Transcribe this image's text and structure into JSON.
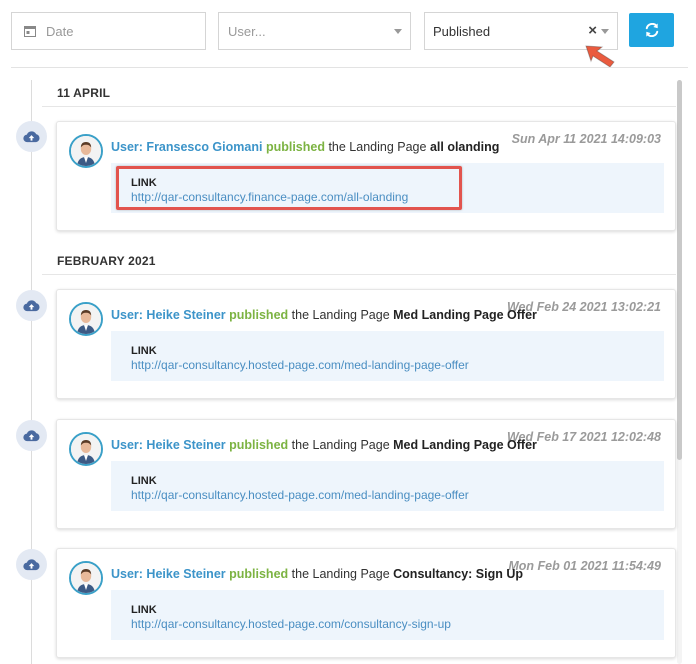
{
  "filters": {
    "date_placeholder": "Date",
    "user_placeholder": "User...",
    "status_value": "Published",
    "clear_symbol": "×"
  },
  "icons": {
    "calendar": "calendar-icon",
    "refresh": "refresh-icon",
    "timeline": "cloud-upload-icon",
    "arrow": "arrow-pointer-icon"
  },
  "colors": {
    "accent": "#1fa5e0",
    "user_link": "#3c94c9",
    "verb_published": "#7cb342",
    "highlight": "#e2544e",
    "link_box": "#eef5fc"
  },
  "sections": [
    {
      "header": "11 APRIL"
    },
    {
      "header": "FEBRUARY 2021"
    }
  ],
  "entries": [
    {
      "timestamp": "Sun Apr 11 2021 14:09:03",
      "user": "User: Fransesco Giomani",
      "verb": "published",
      "object_prefix": "the Landing Page",
      "object_name": "all olanding",
      "link_label": "LINK",
      "link_url": "http://qar-consultancy.finance-page.com/all-olanding"
    },
    {
      "timestamp": "Wed Feb 24 2021 13:02:21",
      "user": "User: Heike Steiner",
      "verb": "published",
      "object_prefix": "the Landing Page",
      "object_name": "Med Landing Page Offer",
      "link_label": "LINK",
      "link_url": "http://qar-consultancy.hosted-page.com/med-landing-page-offer"
    },
    {
      "timestamp": "Wed Feb 17 2021 12:02:48",
      "user": "User: Heike Steiner",
      "verb": "published",
      "object_prefix": "the Landing Page",
      "object_name": "Med Landing Page Offer",
      "link_label": "LINK",
      "link_url": "http://qar-consultancy.hosted-page.com/med-landing-page-offer"
    },
    {
      "timestamp": "Mon Feb 01 2021 11:54:49",
      "user": "User: Heike Steiner",
      "verb": "published",
      "object_prefix": "the Landing Page",
      "object_name": "Consultancy: Sign Up",
      "link_label": "LINK",
      "link_url": "http://qar-consultancy.hosted-page.com/consultancy-sign-up"
    }
  ]
}
